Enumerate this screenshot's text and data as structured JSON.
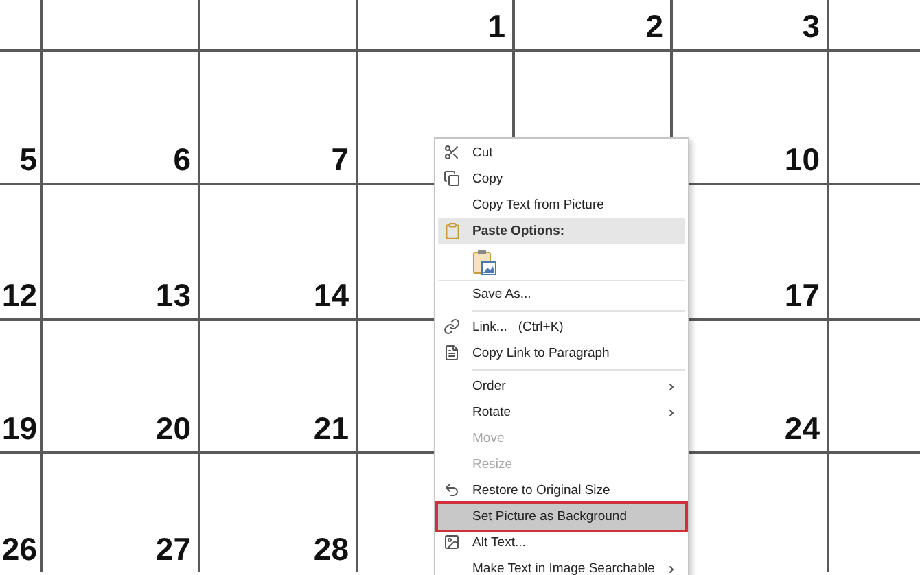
{
  "calendar": {
    "rows": [
      [
        null,
        null,
        null,
        "1",
        "2",
        "3",
        null
      ],
      [
        "5",
        "6",
        "7",
        null,
        null,
        "10",
        null
      ],
      [
        "12",
        "13",
        "14",
        null,
        null,
        "17",
        null
      ],
      [
        "19",
        "20",
        "21",
        null,
        null,
        "24",
        null
      ],
      [
        "26",
        "27",
        "28",
        null,
        null,
        null,
        null
      ]
    ]
  },
  "context_menu": {
    "items": [
      {
        "kind": "item",
        "label": "Cut",
        "disabled": false,
        "submenu": false,
        "selected": false
      },
      {
        "kind": "item",
        "label": "Copy",
        "disabled": false,
        "submenu": false,
        "selected": false
      },
      {
        "kind": "item",
        "label": "Copy Text from Picture",
        "disabled": false,
        "submenu": false,
        "selected": false
      },
      {
        "kind": "header",
        "label": "Paste Options:"
      },
      {
        "kind": "paste"
      },
      {
        "kind": "item",
        "label": "Save As...",
        "disabled": false,
        "submenu": false,
        "selected": false
      },
      {
        "kind": "separator"
      },
      {
        "kind": "item",
        "label": "Link...",
        "shortcut": "(Ctrl+K)",
        "disabled": false,
        "submenu": false,
        "selected": false
      },
      {
        "kind": "item",
        "label": "Copy Link to Paragraph",
        "disabled": false,
        "submenu": false,
        "selected": false
      },
      {
        "kind": "separator"
      },
      {
        "kind": "item",
        "label": "Order",
        "disabled": false,
        "submenu": true,
        "selected": false
      },
      {
        "kind": "item",
        "label": "Rotate",
        "disabled": false,
        "submenu": true,
        "selected": false
      },
      {
        "kind": "item",
        "label": "Move",
        "disabled": true,
        "submenu": false,
        "selected": false
      },
      {
        "kind": "item",
        "label": "Resize",
        "disabled": true,
        "submenu": false,
        "selected": false
      },
      {
        "kind": "item",
        "label": "Restore to Original Size",
        "disabled": false,
        "submenu": false,
        "selected": false
      },
      {
        "kind": "item",
        "label": "Set Picture as Background",
        "disabled": false,
        "submenu": false,
        "selected": true
      },
      {
        "kind": "item",
        "label": "Alt Text...",
        "disabled": false,
        "submenu": false,
        "selected": false
      },
      {
        "kind": "item",
        "label": "Make Text in Image Searchable",
        "disabled": false,
        "submenu": true,
        "selected": false
      }
    ]
  }
}
